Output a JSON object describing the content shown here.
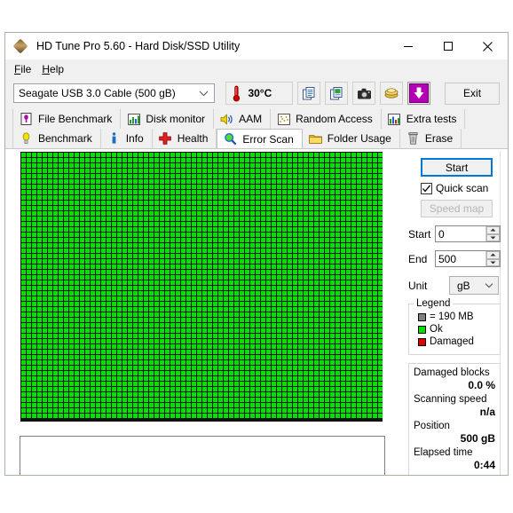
{
  "window": {
    "title": "HD Tune Pro 5.60 - Hard Disk/SSD Utility",
    "app_icon": "diamond-disk-icon",
    "minimize_label": "Minimize",
    "maximize_label": "Maximize",
    "close_label": "Close"
  },
  "menu": {
    "items": [
      {
        "label": "File",
        "accel": "F"
      },
      {
        "label": "Help",
        "accel": "H"
      }
    ]
  },
  "toolbar": {
    "drive": {
      "selected": "Seagate USB 3.0 Cable (500 gB)",
      "icon": "chevron-down-icon"
    },
    "temperature": {
      "value": "30°C",
      "icon": "thermometer-icon"
    },
    "buttons": [
      {
        "name": "copy-icon",
        "label": "Copy"
      },
      {
        "name": "copy-image-icon",
        "label": "Copy image"
      },
      {
        "name": "camera-icon",
        "label": "Screenshot"
      },
      {
        "name": "money-icon",
        "label": "Donate"
      },
      {
        "name": "download-arrow-icon",
        "label": "Save"
      }
    ],
    "exit_label": "Exit"
  },
  "tabs": {
    "row1": [
      {
        "label": "File Benchmark",
        "icon": "file-benchmark-icon",
        "active": false
      },
      {
        "label": "Disk monitor",
        "icon": "bar-chart-icon",
        "active": false
      },
      {
        "label": "AAM",
        "icon": "speaker-icon",
        "active": false
      },
      {
        "label": "Random Access",
        "icon": "scatter-icon",
        "active": false
      },
      {
        "label": "Extra tests",
        "icon": "extra-chart-icon",
        "active": false
      }
    ],
    "row2": [
      {
        "label": "Benchmark",
        "icon": "bulb-icon",
        "active": false
      },
      {
        "label": "Info",
        "icon": "info-icon",
        "active": false
      },
      {
        "label": "Health",
        "icon": "red-cross-icon",
        "active": false
      },
      {
        "label": "Error Scan",
        "icon": "magnifier-icon",
        "active": true
      },
      {
        "label": "Folder Usage",
        "icon": "folder-icon",
        "active": false
      },
      {
        "label": "Erase",
        "icon": "trash-icon",
        "active": false
      }
    ]
  },
  "panel": {
    "start_button": "Start",
    "quick_scan": {
      "label": "Quick scan",
      "checked": true
    },
    "speed_map_button": {
      "label": "Speed map",
      "enabled": false
    },
    "fields": [
      {
        "label": "Start",
        "value": "0"
      },
      {
        "label": "End",
        "value": "500"
      }
    ],
    "unit": {
      "label": "Unit",
      "value": "gB"
    },
    "legend": {
      "title": "Legend",
      "rows": [
        {
          "text": "= 190 MB",
          "color": "#808080"
        },
        {
          "text": "Ok",
          "color": "#00e000"
        },
        {
          "text": "Damaged",
          "color": "#e00000"
        }
      ]
    },
    "stats": [
      {
        "label": "Damaged blocks",
        "value": "0.0 %"
      },
      {
        "label": "Scanning speed",
        "value": "n/a"
      },
      {
        "label": "Position",
        "value": "500 gB"
      },
      {
        "label": "Elapsed time",
        "value": "0:44"
      }
    ]
  },
  "scan_grid": {
    "columns": 68,
    "rows": 50,
    "cell_color_ok": "#00e000",
    "background": "#111111",
    "damaged_cells": []
  },
  "colors": {
    "accent": "#0078d7",
    "ok_green": "#00e000",
    "damaged_red": "#e00000",
    "window_bg": "#f0f0f0"
  }
}
